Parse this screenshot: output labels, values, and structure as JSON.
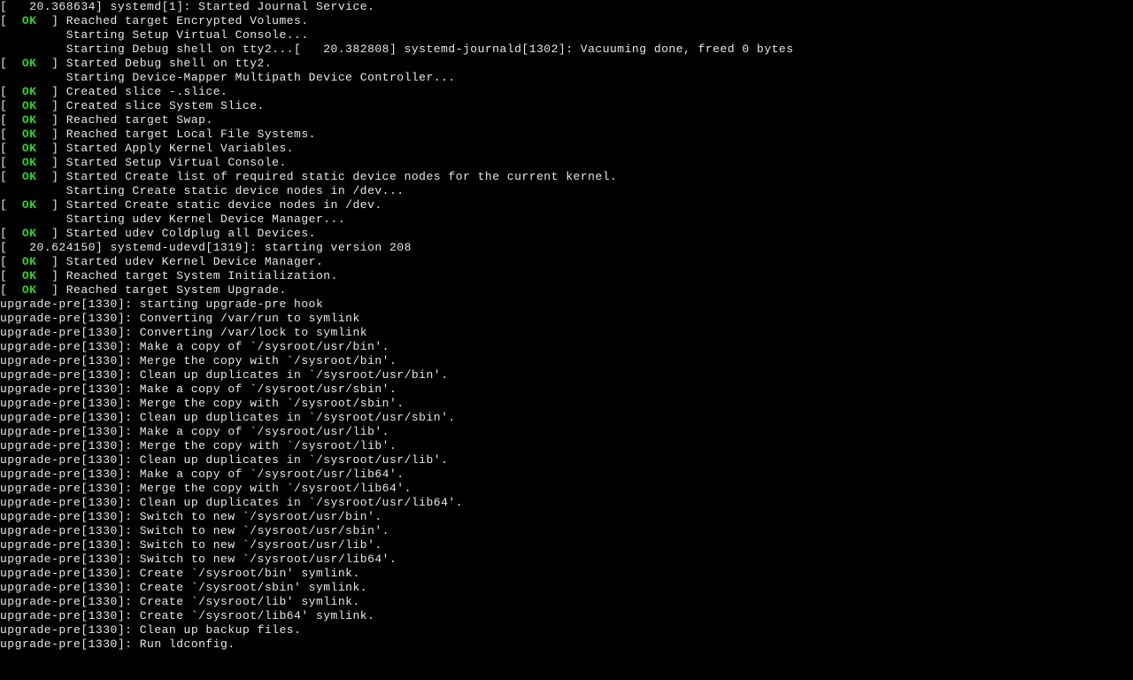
{
  "colors": {
    "ok": "#2cd42c",
    "fg": "#e8e8e8",
    "bg": "#000000"
  },
  "lines": [
    {
      "segs": [
        {
          "t": "[   20.368634] systemd[1]: Started Journal Service."
        }
      ]
    },
    {
      "segs": [
        {
          "t": "[  "
        },
        {
          "t": "OK",
          "c": "ok"
        },
        {
          "t": "  ] Reached target Encrypted Volumes."
        }
      ]
    },
    {
      "segs": [
        {
          "t": "         Starting Setup Virtual Console..."
        }
      ]
    },
    {
      "segs": [
        {
          "t": "         Starting Debug shell on tty2...[   20.382808] systemd-journald[1302]: Vacuuming done, freed 0 bytes"
        }
      ]
    },
    {
      "segs": [
        {
          "t": ""
        }
      ]
    },
    {
      "segs": [
        {
          "t": "[  "
        },
        {
          "t": "OK",
          "c": "ok"
        },
        {
          "t": "  ] Started Debug shell on tty2."
        }
      ]
    },
    {
      "segs": [
        {
          "t": "         Starting Device-Mapper Multipath Device Controller..."
        }
      ]
    },
    {
      "segs": [
        {
          "t": "[  "
        },
        {
          "t": "OK",
          "c": "ok"
        },
        {
          "t": "  ] Created slice -.slice."
        }
      ]
    },
    {
      "segs": [
        {
          "t": "[  "
        },
        {
          "t": "OK",
          "c": "ok"
        },
        {
          "t": "  ] Created slice System Slice."
        }
      ]
    },
    {
      "segs": [
        {
          "t": "[  "
        },
        {
          "t": "OK",
          "c": "ok"
        },
        {
          "t": "  ] Reached target Swap."
        }
      ]
    },
    {
      "segs": [
        {
          "t": "[  "
        },
        {
          "t": "OK",
          "c": "ok"
        },
        {
          "t": "  ] Reached target Local File Systems."
        }
      ]
    },
    {
      "segs": [
        {
          "t": "[  "
        },
        {
          "t": "OK",
          "c": "ok"
        },
        {
          "t": "  ] Started Apply Kernel Variables."
        }
      ]
    },
    {
      "segs": [
        {
          "t": "[  "
        },
        {
          "t": "OK",
          "c": "ok"
        },
        {
          "t": "  ] Started Setup Virtual Console."
        }
      ]
    },
    {
      "segs": [
        {
          "t": "[  "
        },
        {
          "t": "OK",
          "c": "ok"
        },
        {
          "t": "  ] Started Create list of required static device nodes for the current kernel."
        }
      ]
    },
    {
      "segs": [
        {
          "t": "         Starting Create static device nodes in /dev..."
        }
      ]
    },
    {
      "segs": [
        {
          "t": "[  "
        },
        {
          "t": "OK",
          "c": "ok"
        },
        {
          "t": "  ] Started Create static device nodes in /dev."
        }
      ]
    },
    {
      "segs": [
        {
          "t": "         Starting udev Kernel Device Manager..."
        }
      ]
    },
    {
      "segs": [
        {
          "t": "[  "
        },
        {
          "t": "OK",
          "c": "ok"
        },
        {
          "t": "  ] Started udev Coldplug all Devices."
        }
      ]
    },
    {
      "segs": [
        {
          "t": "[   20.624150] systemd-udevd[1319]: starting version 208"
        }
      ]
    },
    {
      "segs": [
        {
          "t": "[  "
        },
        {
          "t": "OK",
          "c": "ok"
        },
        {
          "t": "  ] Started udev Kernel Device Manager."
        }
      ]
    },
    {
      "segs": [
        {
          "t": "[  "
        },
        {
          "t": "OK",
          "c": "ok"
        },
        {
          "t": "  ] Reached target System Initialization."
        }
      ]
    },
    {
      "segs": [
        {
          "t": "[  "
        },
        {
          "t": "OK",
          "c": "ok"
        },
        {
          "t": "  ] Reached target System Upgrade."
        }
      ]
    },
    {
      "segs": [
        {
          "t": "upgrade-pre[1330]: starting upgrade-pre hook"
        }
      ]
    },
    {
      "segs": [
        {
          "t": "upgrade-pre[1330]: Converting /var/run to symlink"
        }
      ]
    },
    {
      "segs": [
        {
          "t": "upgrade-pre[1330]: Converting /var/lock to symlink"
        }
      ]
    },
    {
      "segs": [
        {
          "t": "upgrade-pre[1330]: Make a copy of `/sysroot/usr/bin'."
        }
      ]
    },
    {
      "segs": [
        {
          "t": "upgrade-pre[1330]: Merge the copy with `/sysroot/bin'."
        }
      ]
    },
    {
      "segs": [
        {
          "t": "upgrade-pre[1330]: Clean up duplicates in `/sysroot/usr/bin'."
        }
      ]
    },
    {
      "segs": [
        {
          "t": "upgrade-pre[1330]: Make a copy of `/sysroot/usr/sbin'."
        }
      ]
    },
    {
      "segs": [
        {
          "t": "upgrade-pre[1330]: Merge the copy with `/sysroot/sbin'."
        }
      ]
    },
    {
      "segs": [
        {
          "t": "upgrade-pre[1330]: Clean up duplicates in `/sysroot/usr/sbin'."
        }
      ]
    },
    {
      "segs": [
        {
          "t": "upgrade-pre[1330]: Make a copy of `/sysroot/usr/lib'."
        }
      ]
    },
    {
      "segs": [
        {
          "t": "upgrade-pre[1330]: Merge the copy with `/sysroot/lib'."
        }
      ]
    },
    {
      "segs": [
        {
          "t": "upgrade-pre[1330]: Clean up duplicates in `/sysroot/usr/lib'."
        }
      ]
    },
    {
      "segs": [
        {
          "t": "upgrade-pre[1330]: Make a copy of `/sysroot/usr/lib64'."
        }
      ]
    },
    {
      "segs": [
        {
          "t": "upgrade-pre[1330]: Merge the copy with `/sysroot/lib64'."
        }
      ]
    },
    {
      "segs": [
        {
          "t": "upgrade-pre[1330]: Clean up duplicates in `/sysroot/usr/lib64'."
        }
      ]
    },
    {
      "segs": [
        {
          "t": "upgrade-pre[1330]: Switch to new `/sysroot/usr/bin'."
        }
      ]
    },
    {
      "segs": [
        {
          "t": "upgrade-pre[1330]: Switch to new `/sysroot/usr/sbin'."
        }
      ]
    },
    {
      "segs": [
        {
          "t": "upgrade-pre[1330]: Switch to new `/sysroot/usr/lib'."
        }
      ]
    },
    {
      "segs": [
        {
          "t": "upgrade-pre[1330]: Switch to new `/sysroot/usr/lib64'."
        }
      ]
    },
    {
      "segs": [
        {
          "t": "upgrade-pre[1330]: Create `/sysroot/bin' symlink."
        }
      ]
    },
    {
      "segs": [
        {
          "t": "upgrade-pre[1330]: Create `/sysroot/sbin' symlink."
        }
      ]
    },
    {
      "segs": [
        {
          "t": "upgrade-pre[1330]: Create `/sysroot/lib' symlink."
        }
      ]
    },
    {
      "segs": [
        {
          "t": "upgrade-pre[1330]: Create `/sysroot/lib64' symlink."
        }
      ]
    },
    {
      "segs": [
        {
          "t": "upgrade-pre[1330]: Clean up backup files."
        }
      ]
    },
    {
      "segs": [
        {
          "t": "upgrade-pre[1330]: Run ldconfig."
        }
      ]
    }
  ]
}
